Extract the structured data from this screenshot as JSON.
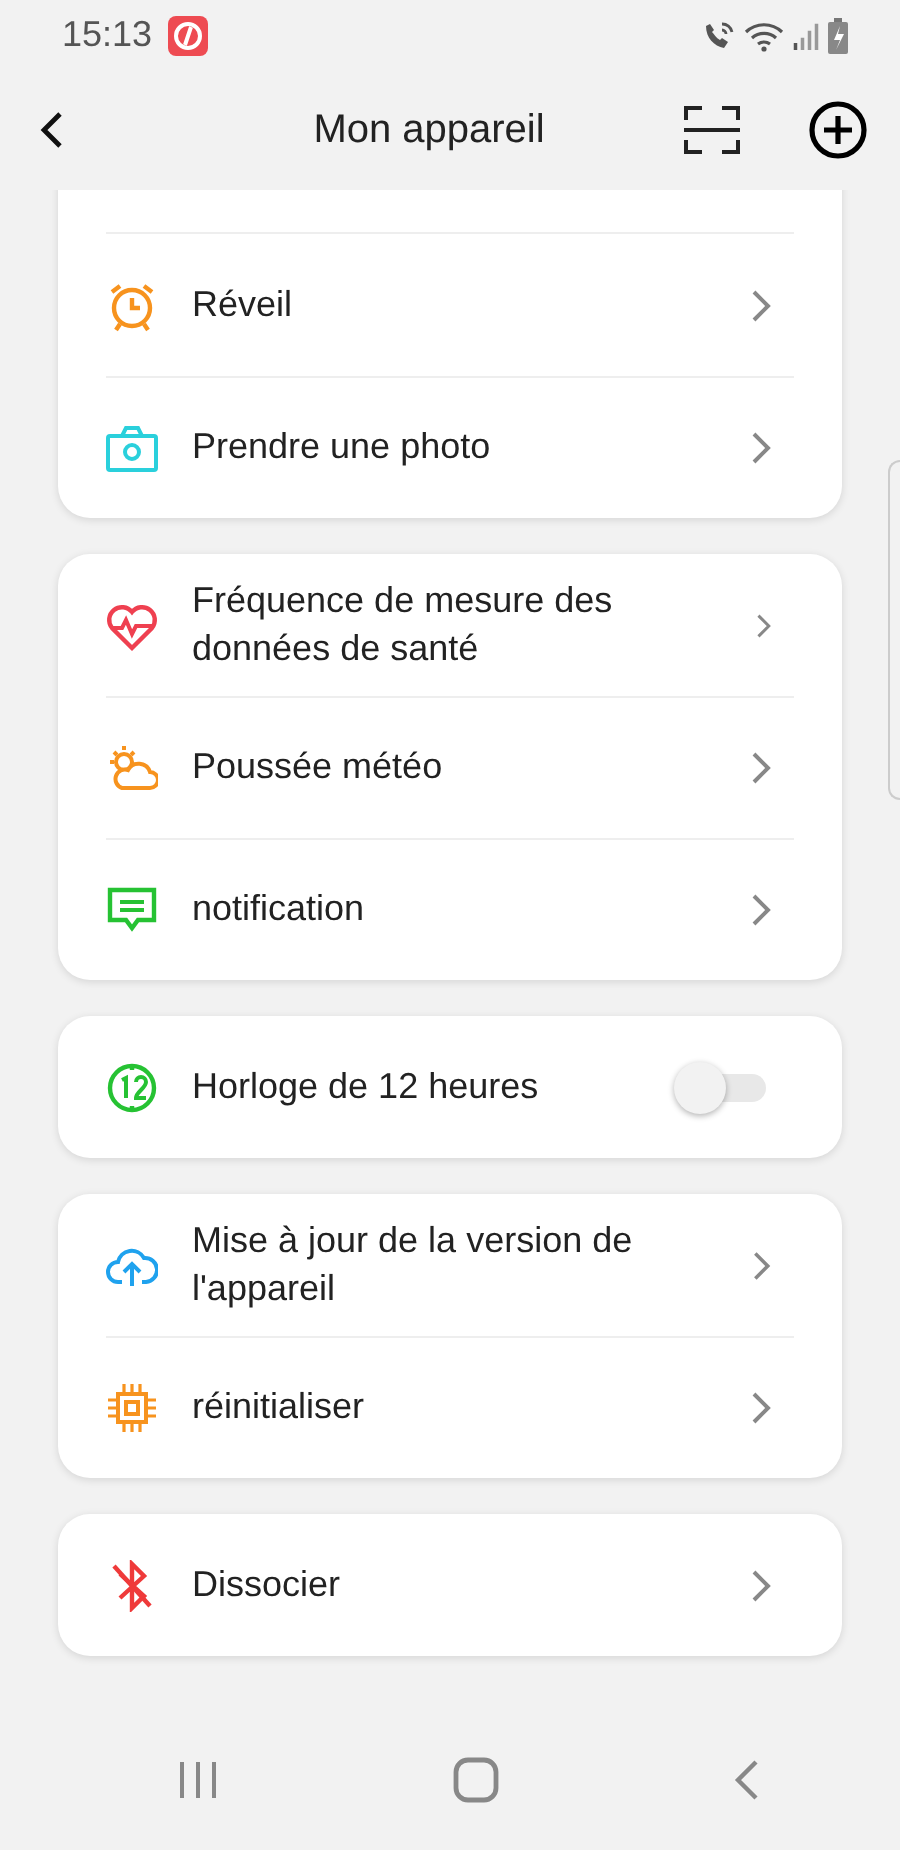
{
  "status_bar": {
    "time": "15:13"
  },
  "header": {
    "title": "Mon appareil"
  },
  "groups": [
    {
      "items": [
        {
          "kind": "link",
          "label": "Réveil"
        },
        {
          "kind": "link",
          "label": "Prendre une photo"
        }
      ]
    },
    {
      "items": [
        {
          "kind": "link",
          "label": "Fréquence de mesure des données de santé"
        },
        {
          "kind": "link",
          "label": "Poussée météo"
        },
        {
          "kind": "link",
          "label": "notification"
        }
      ]
    },
    {
      "items": [
        {
          "kind": "toggle",
          "label": "Horloge de 12 heures",
          "on": false
        }
      ]
    },
    {
      "items": [
        {
          "kind": "link",
          "label": "Mise à jour de la version de l'appareil"
        },
        {
          "kind": "link",
          "label": "réinitialiser"
        }
      ]
    },
    {
      "items": [
        {
          "kind": "link",
          "label": "Dissocier"
        }
      ]
    }
  ]
}
